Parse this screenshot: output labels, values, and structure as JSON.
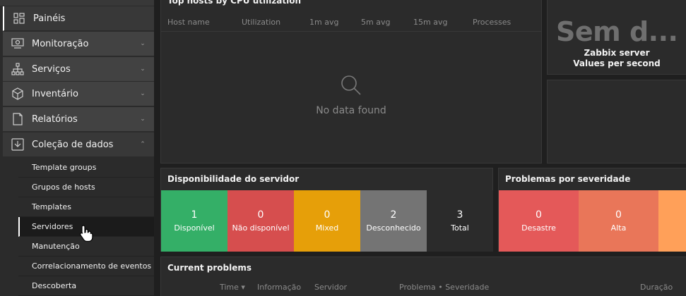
{
  "sidebar": {
    "items": [
      {
        "label": "Painéis",
        "icon": "dashboard-icon"
      },
      {
        "label": "Monitoração",
        "icon": "monitoring-icon"
      },
      {
        "label": "Serviços",
        "icon": "services-icon"
      },
      {
        "label": "Inventário",
        "icon": "inventory-icon"
      },
      {
        "label": "Relatórios",
        "icon": "reports-icon"
      },
      {
        "label": "Coleção de dados",
        "icon": "data-collection-icon"
      }
    ],
    "submenu": [
      "Template groups",
      "Grupos de hosts",
      "Templates",
      "Servidores",
      "Manutenção",
      "Correlacionamento de eventos",
      "Descoberta"
    ],
    "selected_submenu": "Servidores"
  },
  "tophosts": {
    "title": "Top hosts by CPU utilization",
    "columns": [
      "Host name",
      "Utilization",
      "1m avg",
      "5m avg",
      "15m avg",
      "Processes"
    ],
    "empty_text": "No data found"
  },
  "itemvalue": {
    "big_text": "Sem d...",
    "line1": "Zabbix server",
    "line2": "Values per second"
  },
  "availability": {
    "title": "Disponibilidade do servidor",
    "tiles": [
      {
        "value": "1",
        "label": "Disponível",
        "color": "#34af67"
      },
      {
        "value": "0",
        "label": "Não disponível",
        "color": "#d64e4e"
      },
      {
        "value": "0",
        "label": "Mixed",
        "color": "#e69f09"
      },
      {
        "value": "2",
        "label": "Desconhecido",
        "color": "#747474"
      },
      {
        "value": "3",
        "label": "Total",
        "color": "#2b2b2b"
      }
    ]
  },
  "problems_by_severity": {
    "title": "Problemas por severidade",
    "tiles": [
      {
        "value": "0",
        "label": "Desastre",
        "color": "#e45959"
      },
      {
        "value": "0",
        "label": "Alta",
        "color": "#e97659"
      },
      {
        "value": "",
        "label": "",
        "color": "#ffa059"
      }
    ]
  },
  "current_problems": {
    "title": "Current problems",
    "columns": [
      "Time ▾",
      "Informação",
      "Servidor",
      "Problema • Severidade",
      "Duração"
    ]
  }
}
